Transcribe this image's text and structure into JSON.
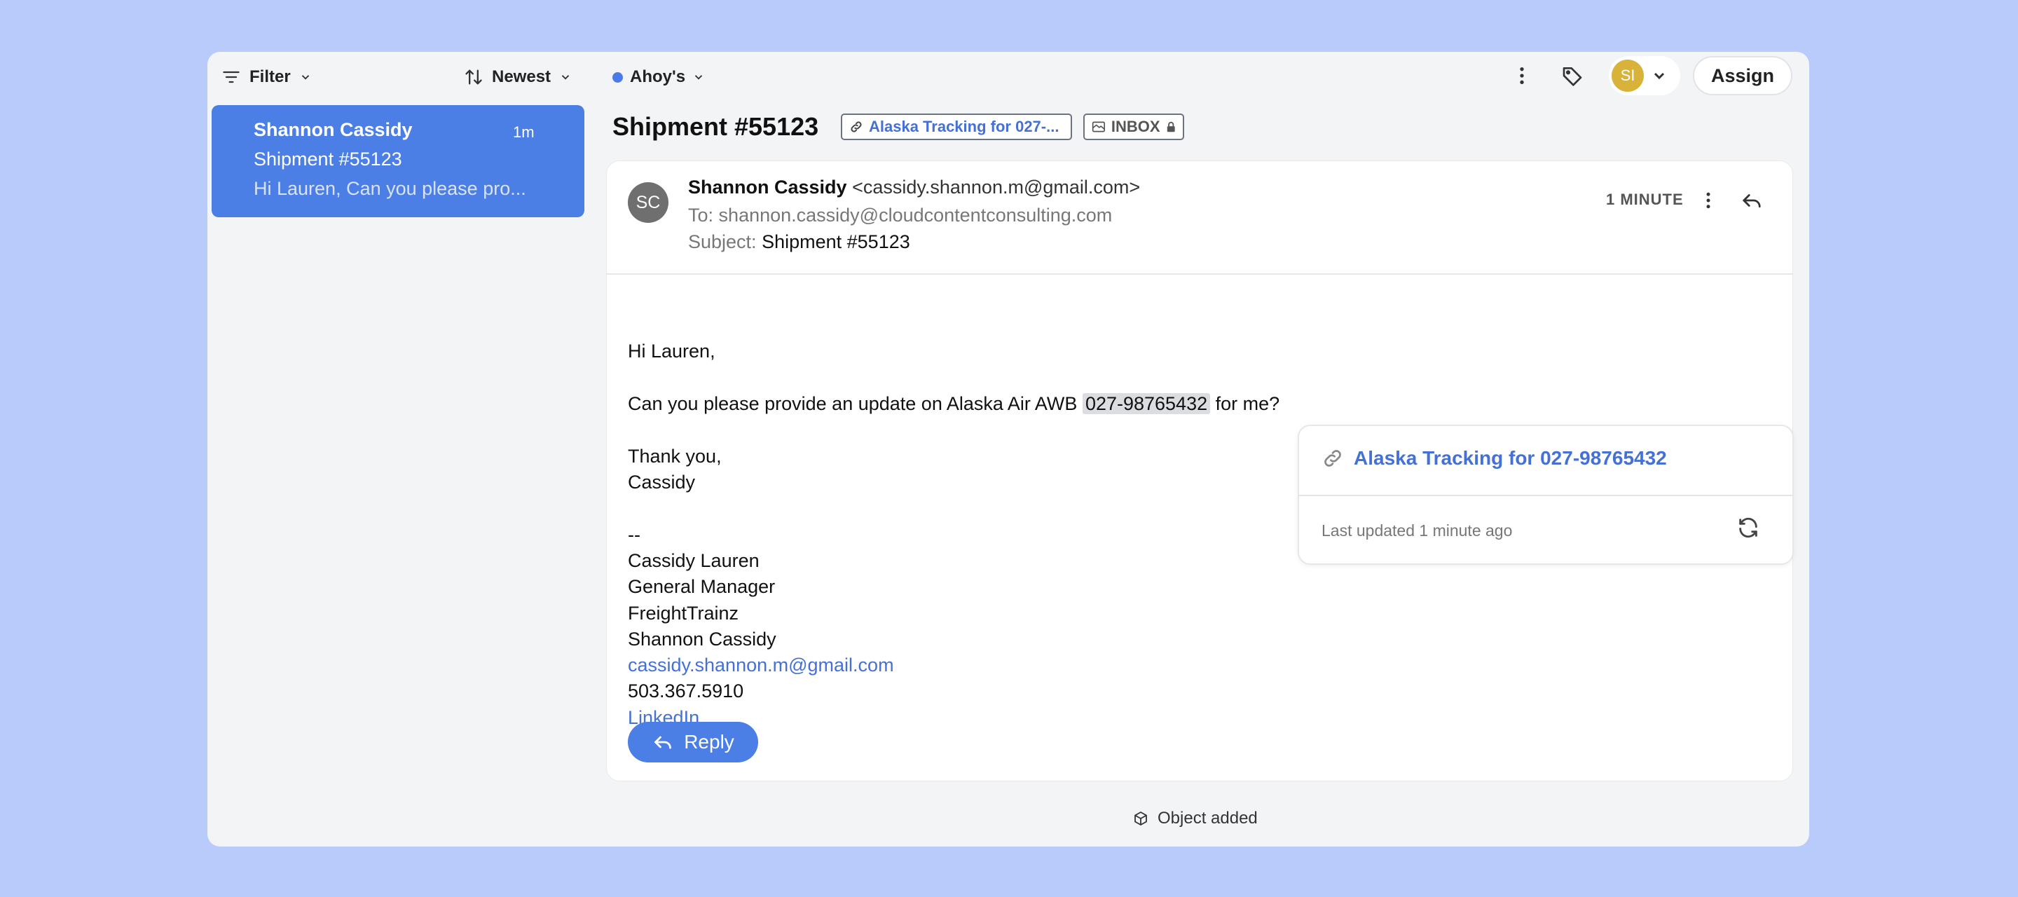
{
  "toolbar": {
    "filter_label": "Filter",
    "sort_label": "Newest",
    "inbox_label": "Ahoy's",
    "avatar_initials": "SI",
    "assign_label": "Assign"
  },
  "conversation": {
    "name": "Shannon Cassidy",
    "time": "1m",
    "subject": "Shipment #55123",
    "preview": "Hi Lauren, Can you please pro..."
  },
  "thread": {
    "title": "Shipment #55123",
    "link_tag": "Alaska Tracking for 027-...",
    "inbox_tag": "INBOX"
  },
  "message": {
    "avatar_initials": "SC",
    "from_name": "Shannon Cassidy",
    "from_email": "<cassidy.shannon.m@gmail.com>",
    "to_label": "To:",
    "to_value": "shannon.cassidy@cloudcontentconsulting.com",
    "subject_label": "Subject:",
    "subject_value": "Shipment #55123",
    "time": "1 MINUTE",
    "greeting": "Hi Lauren,",
    "body_pre": "Can you please provide an update on Alaska Air AWB",
    "awb": "027-98765432",
    "body_post": "for me?",
    "thanks": "Thank you,",
    "sign_name": "Cassidy",
    "sig_sep": "--",
    "sig_line1": "Cassidy Lauren",
    "sig_line2": "General Manager",
    "sig_line3": "FreightTrainz",
    "sig_line4": "Shannon Cassidy",
    "sig_email": "cassidy.shannon.m@gmail.com",
    "sig_phone": "503.367.5910",
    "sig_linkedin": "LinkedIn",
    "reply_label": "Reply"
  },
  "popup": {
    "title": "Alaska Tracking for 027-98765432",
    "updated": "Last updated 1 minute ago"
  },
  "footer": {
    "status": "Object added"
  },
  "colors": {
    "accent": "#4b7fe6",
    "background": "#b9cbfa",
    "link": "#4570d4"
  }
}
